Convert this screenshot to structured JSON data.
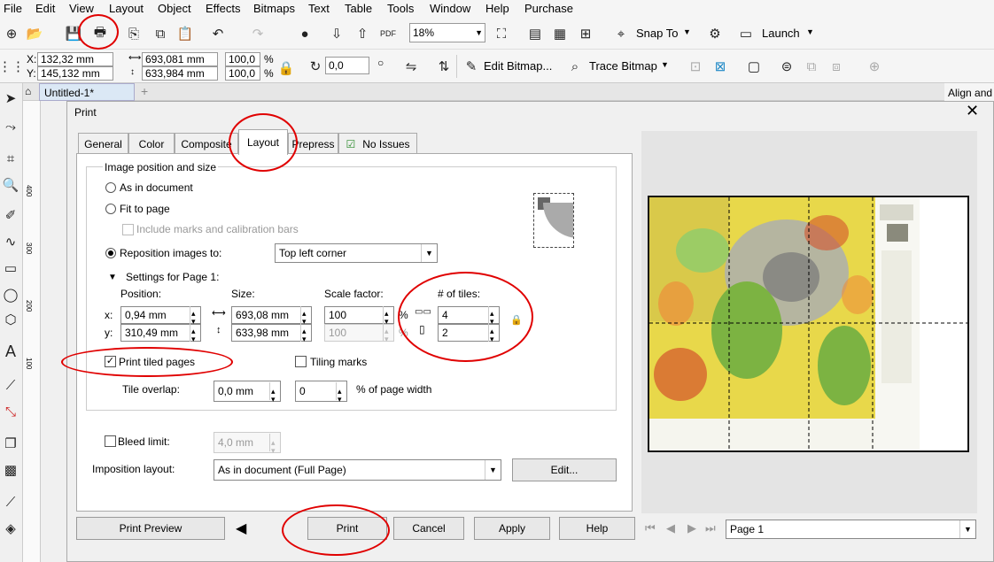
{
  "menu": [
    "File",
    "Edit",
    "View",
    "Layout",
    "Object",
    "Effects",
    "Bitmaps",
    "Text",
    "Table",
    "Tools",
    "Window",
    "Help",
    "Purchase"
  ],
  "toolbar": {
    "zoom": "18%",
    "snap_to": "Snap To",
    "launch": "Launch"
  },
  "property_bar": {
    "x_label": "X:",
    "x": "132,32 mm",
    "y_label": "Y:",
    "y": "145,132 mm",
    "width": "693,081 mm",
    "height": "633,984 mm",
    "scale_w": "100,0",
    "scale_h": "100,0",
    "pct": "%",
    "pct2": "%",
    "angle": "0,0",
    "edit_bitmap": "Edit Bitmap...",
    "trace_bitmap": "Trace Bitmap"
  },
  "doc_tab": {
    "title": "Untitled-1*",
    "plus": "+"
  },
  "docker_title": "Align and",
  "ruler_labels": [
    "400",
    "300",
    "200",
    "100"
  ],
  "dialog": {
    "title": "Print",
    "close": "✕",
    "tabs": [
      "General",
      "Color",
      "Composite",
      "Layout",
      "Prepress",
      "No Issues"
    ],
    "group_title": "Image position and size",
    "as_in_document": "As in document",
    "fit_to_page": "Fit to page",
    "include_marks": "Include marks and calibration bars",
    "reposition": "Reposition images to:",
    "reposition_value": "Top left corner",
    "settings_title": "Settings for Page 1:",
    "position_label": "Position:",
    "size_label": "Size:",
    "scale_label": "Scale factor:",
    "tiles_label": "# of tiles:",
    "x_label": "x:",
    "y_label": "y:",
    "pos_x": "0,94 mm",
    "pos_y": "310,49 mm",
    "size_w": "693,08 mm",
    "size_h": "633,98 mm",
    "scale_x": "100",
    "scale_y": "100",
    "pct": "%",
    "tiles_x": "4",
    "tiles_y": "2",
    "print_tiled": "Print tiled pages",
    "tiling_marks": "Tiling marks",
    "tile_overlap": "Tile overlap:",
    "overlap_mm": "0,0 mm",
    "overlap_pct": "0",
    "pct_width": "% of page width",
    "bleed_limit": "Bleed limit:",
    "bleed_value": "4,0 mm",
    "imposition_label": "Imposition layout:",
    "imposition_value": "As in document (Full Page)",
    "edit": "Edit...",
    "print_preview": "Print Preview",
    "print": "Print",
    "cancel": "Cancel",
    "apply": "Apply",
    "help": "Help",
    "page_select": "Page 1"
  },
  "colors": {
    "accent_red": "#e00000",
    "map_green": "#7cb342",
    "map_yellow": "#e8d84a"
  }
}
